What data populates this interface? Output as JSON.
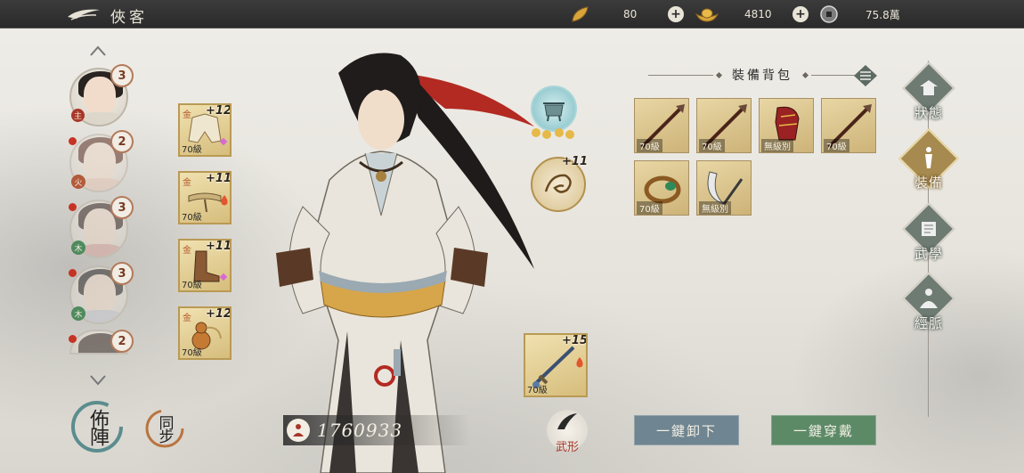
{
  "header": {
    "title": "俠客"
  },
  "resources": [
    {
      "name": "gold-leaf",
      "value": "80"
    },
    {
      "name": "gold-ingot",
      "value": "4810"
    },
    {
      "name": "copper-coin",
      "value": "75.8萬"
    }
  ],
  "roster": [
    {
      "stars": "3",
      "leader_tag": "主"
    },
    {
      "stars": "2",
      "elem_tag": "火"
    },
    {
      "stars": "3",
      "elem_tag": "木"
    },
    {
      "stars": "3",
      "elem_tag": "木"
    },
    {
      "stars": "2"
    }
  ],
  "bottom_left": {
    "formation_label": "佈陣",
    "sync_label": "同步"
  },
  "equipped": [
    {
      "tag": "金",
      "enh": "+12",
      "level": "70級",
      "item": "robe"
    },
    {
      "tag": "金",
      "enh": "+11",
      "level": "70級",
      "item": "belt"
    },
    {
      "tag": "金",
      "enh": "+11",
      "level": "70級",
      "item": "boots"
    },
    {
      "tag": "金",
      "enh": "+12",
      "level": "70級",
      "item": "gourd"
    }
  ],
  "weapon_slot": {
    "enh": "+15",
    "level": "70級"
  },
  "accessory": {
    "enh": "+11"
  },
  "power": {
    "value": "1760933"
  },
  "wuxing_label": "武形",
  "bag": {
    "title": "裝備背包",
    "items": [
      {
        "level": "70級",
        "item": "spear"
      },
      {
        "level": "70級",
        "item": "spear"
      },
      {
        "level": "無級別",
        "item": "red-gauntlet"
      },
      {
        "level": "70級",
        "item": "spear"
      },
      {
        "level": "70級",
        "item": "jade-ring"
      },
      {
        "level": "無級別",
        "item": "crescent-blade"
      }
    ]
  },
  "actions": {
    "unequip_all": "一鍵卸下",
    "equip_all": "一鍵穿戴"
  },
  "nav": [
    {
      "label": "狀態",
      "active": false
    },
    {
      "label": "裝備",
      "active": true
    },
    {
      "label": "武學",
      "active": false
    },
    {
      "label": "經脈",
      "active": false
    }
  ],
  "colors": {
    "unequip_btn": "#6f8591",
    "equip_btn": "#5c8a66",
    "active_nav": "#a78a4f",
    "nav": "#6e7b73"
  }
}
